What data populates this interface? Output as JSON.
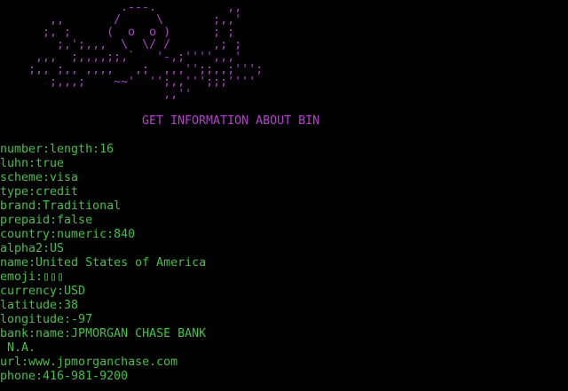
{
  "colors": {
    "background": "#000000",
    "banner": "#b042c8",
    "output": "#3fc43f"
  },
  "banner_art": "                 .---.          ,,\n       ,,       /     \\       ;,,'\n      ;, ;     (  o  o )      ; ;\n        ;,';,,,  \\  \\/ /      ,; ;\n     ,,,  ;,,,,;;,`   '-,;'''',,,'\n    ;,, ;,, ,,,,   ,;  ,,,'';;,,;''';\n       ;,,,;    ~~'  '';,,''';;;''''\n                       ,,''",
  "title": "GET INFORMATION ABOUT BIN",
  "output_lines": [
    "number:length:16",
    "luhn:true",
    "scheme:visa",
    "type:credit",
    "brand:Traditional",
    "prepaid:false",
    "country:numeric:840",
    "alpha2:US",
    "name:United States of America",
    "emoji:▯▯▯",
    "currency:USD",
    "latitude:38",
    "longitude:-97",
    "bank:name:JPMORGAN CHASE BANK",
    " N.A.",
    "url:www.jpmorganchase.com",
    "phone:416-981-9200"
  ]
}
